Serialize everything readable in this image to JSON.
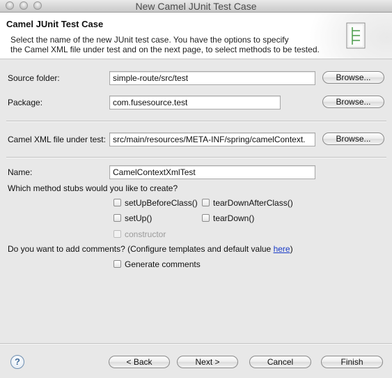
{
  "window": {
    "title": "New Camel JUnit Test Case"
  },
  "header": {
    "title": "Camel JUnit Test Case",
    "description_line1": "Select the name of the new JUnit test case. You have the options to specify",
    "description_line2": "the Camel XML file under test and on the next page, to select methods to be tested.",
    "icon": "junit-wizard-icon"
  },
  "form": {
    "source_folder": {
      "label": "Source folder:",
      "value": "simple-route/src/test",
      "button": "Browse..."
    },
    "package": {
      "label": "Package:",
      "value": "com.fusesource.test",
      "button": "Browse..."
    },
    "camel_xml": {
      "label": "Camel XML file under test:",
      "value": "src/main/resources/META-INF/spring/camelContext.",
      "button": "Browse..."
    },
    "name": {
      "label": "Name:",
      "value": "CamelContextXmlTest"
    }
  },
  "stubs": {
    "question": "Which method stubs would you like to create?",
    "options": [
      {
        "label": "setUpBeforeClass()",
        "checked": false,
        "enabled": true
      },
      {
        "label": "tearDownAfterClass()",
        "checked": false,
        "enabled": true
      },
      {
        "label": "setUp()",
        "checked": false,
        "enabled": true
      },
      {
        "label": "tearDown()",
        "checked": false,
        "enabled": true
      },
      {
        "label": "constructor",
        "checked": false,
        "enabled": false
      }
    ]
  },
  "comments": {
    "question_prefix": "Do you want to add comments? (Configure templates and default value ",
    "link": "here",
    "question_suffix": ")",
    "checkbox_label": "Generate comments",
    "checked": false
  },
  "footer": {
    "help_icon": "help-icon",
    "back": "< Back",
    "next": "Next >",
    "cancel": "Cancel",
    "finish": "Finish"
  }
}
